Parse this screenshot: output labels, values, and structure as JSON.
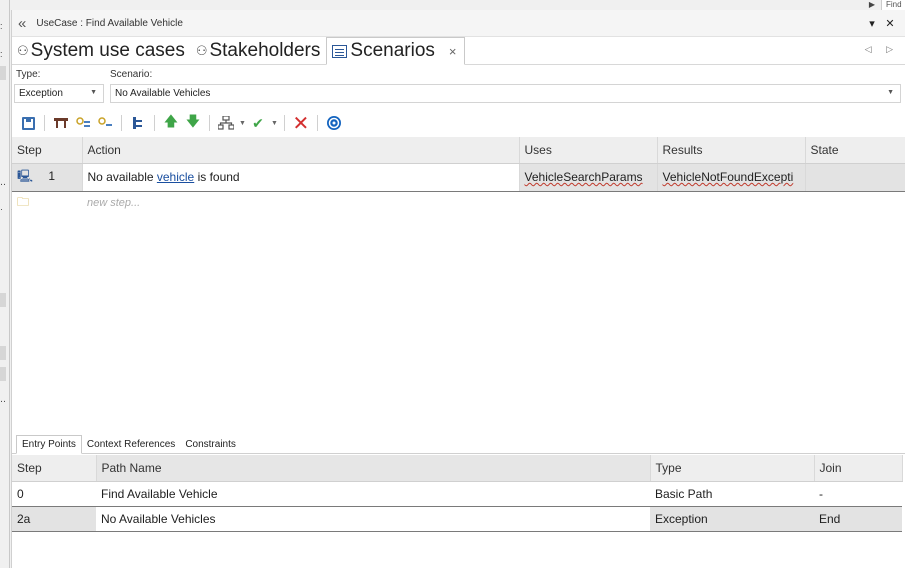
{
  "window": {
    "title": "UseCase : Find Available Vehicle",
    "collapse_glyph": "«",
    "menu_glyph": "▾",
    "close_glyph": "✕",
    "corner_text": "Find"
  },
  "tabs": [
    {
      "label": "System use cases",
      "icon": "actors-icon",
      "glyph": "⚇"
    },
    {
      "label": "Stakeholders",
      "icon": "actors-icon",
      "glyph": "⚇"
    },
    {
      "label": "Scenarios",
      "icon": "document-icon",
      "active": true,
      "close_glyph": "×"
    }
  ],
  "tab_nav": "◁ ▷",
  "fields": {
    "type_label": "Type:",
    "type_value": "Exception",
    "scenario_label": "Scenario:",
    "scenario_value": "No Available Vehicles"
  },
  "toolbar": {
    "icons": [
      "save-icon",
      "link-icon",
      "add-actor-icon",
      "actor-icon",
      "structure-icon",
      "move-up-icon",
      "move-down-icon",
      "generate-icon",
      "validate-icon",
      "delete-icon",
      "help-icon"
    ],
    "colors": {
      "save": "#3a6fb0",
      "move": "#3fa548",
      "validate": "#3fa548",
      "delete": "#d32f2f",
      "help": "#1565c0"
    }
  },
  "steps_table": {
    "headers": [
      "Step",
      "Action",
      "Uses",
      "Results",
      "State"
    ],
    "rows": [
      {
        "step": "1",
        "action_pre": "No available ",
        "action_link": "vehicle",
        "action_post": " is found",
        "uses": "VehicleSearchParams",
        "results": "VehicleNotFoundExcepti",
        "state": ""
      }
    ],
    "new_step_placeholder": "new step..."
  },
  "subtabs": [
    "Entry Points",
    "Context References",
    "Constraints"
  ],
  "paths_table": {
    "headers": [
      "Step",
      "Path Name",
      "Type",
      "Join"
    ],
    "rows": [
      {
        "step": "0",
        "name": "Find Available Vehicle",
        "type": "Basic Path",
        "join": "-"
      },
      {
        "step": "2a",
        "name": "No Available Vehicles",
        "type": "Exception",
        "join": "End"
      }
    ]
  }
}
